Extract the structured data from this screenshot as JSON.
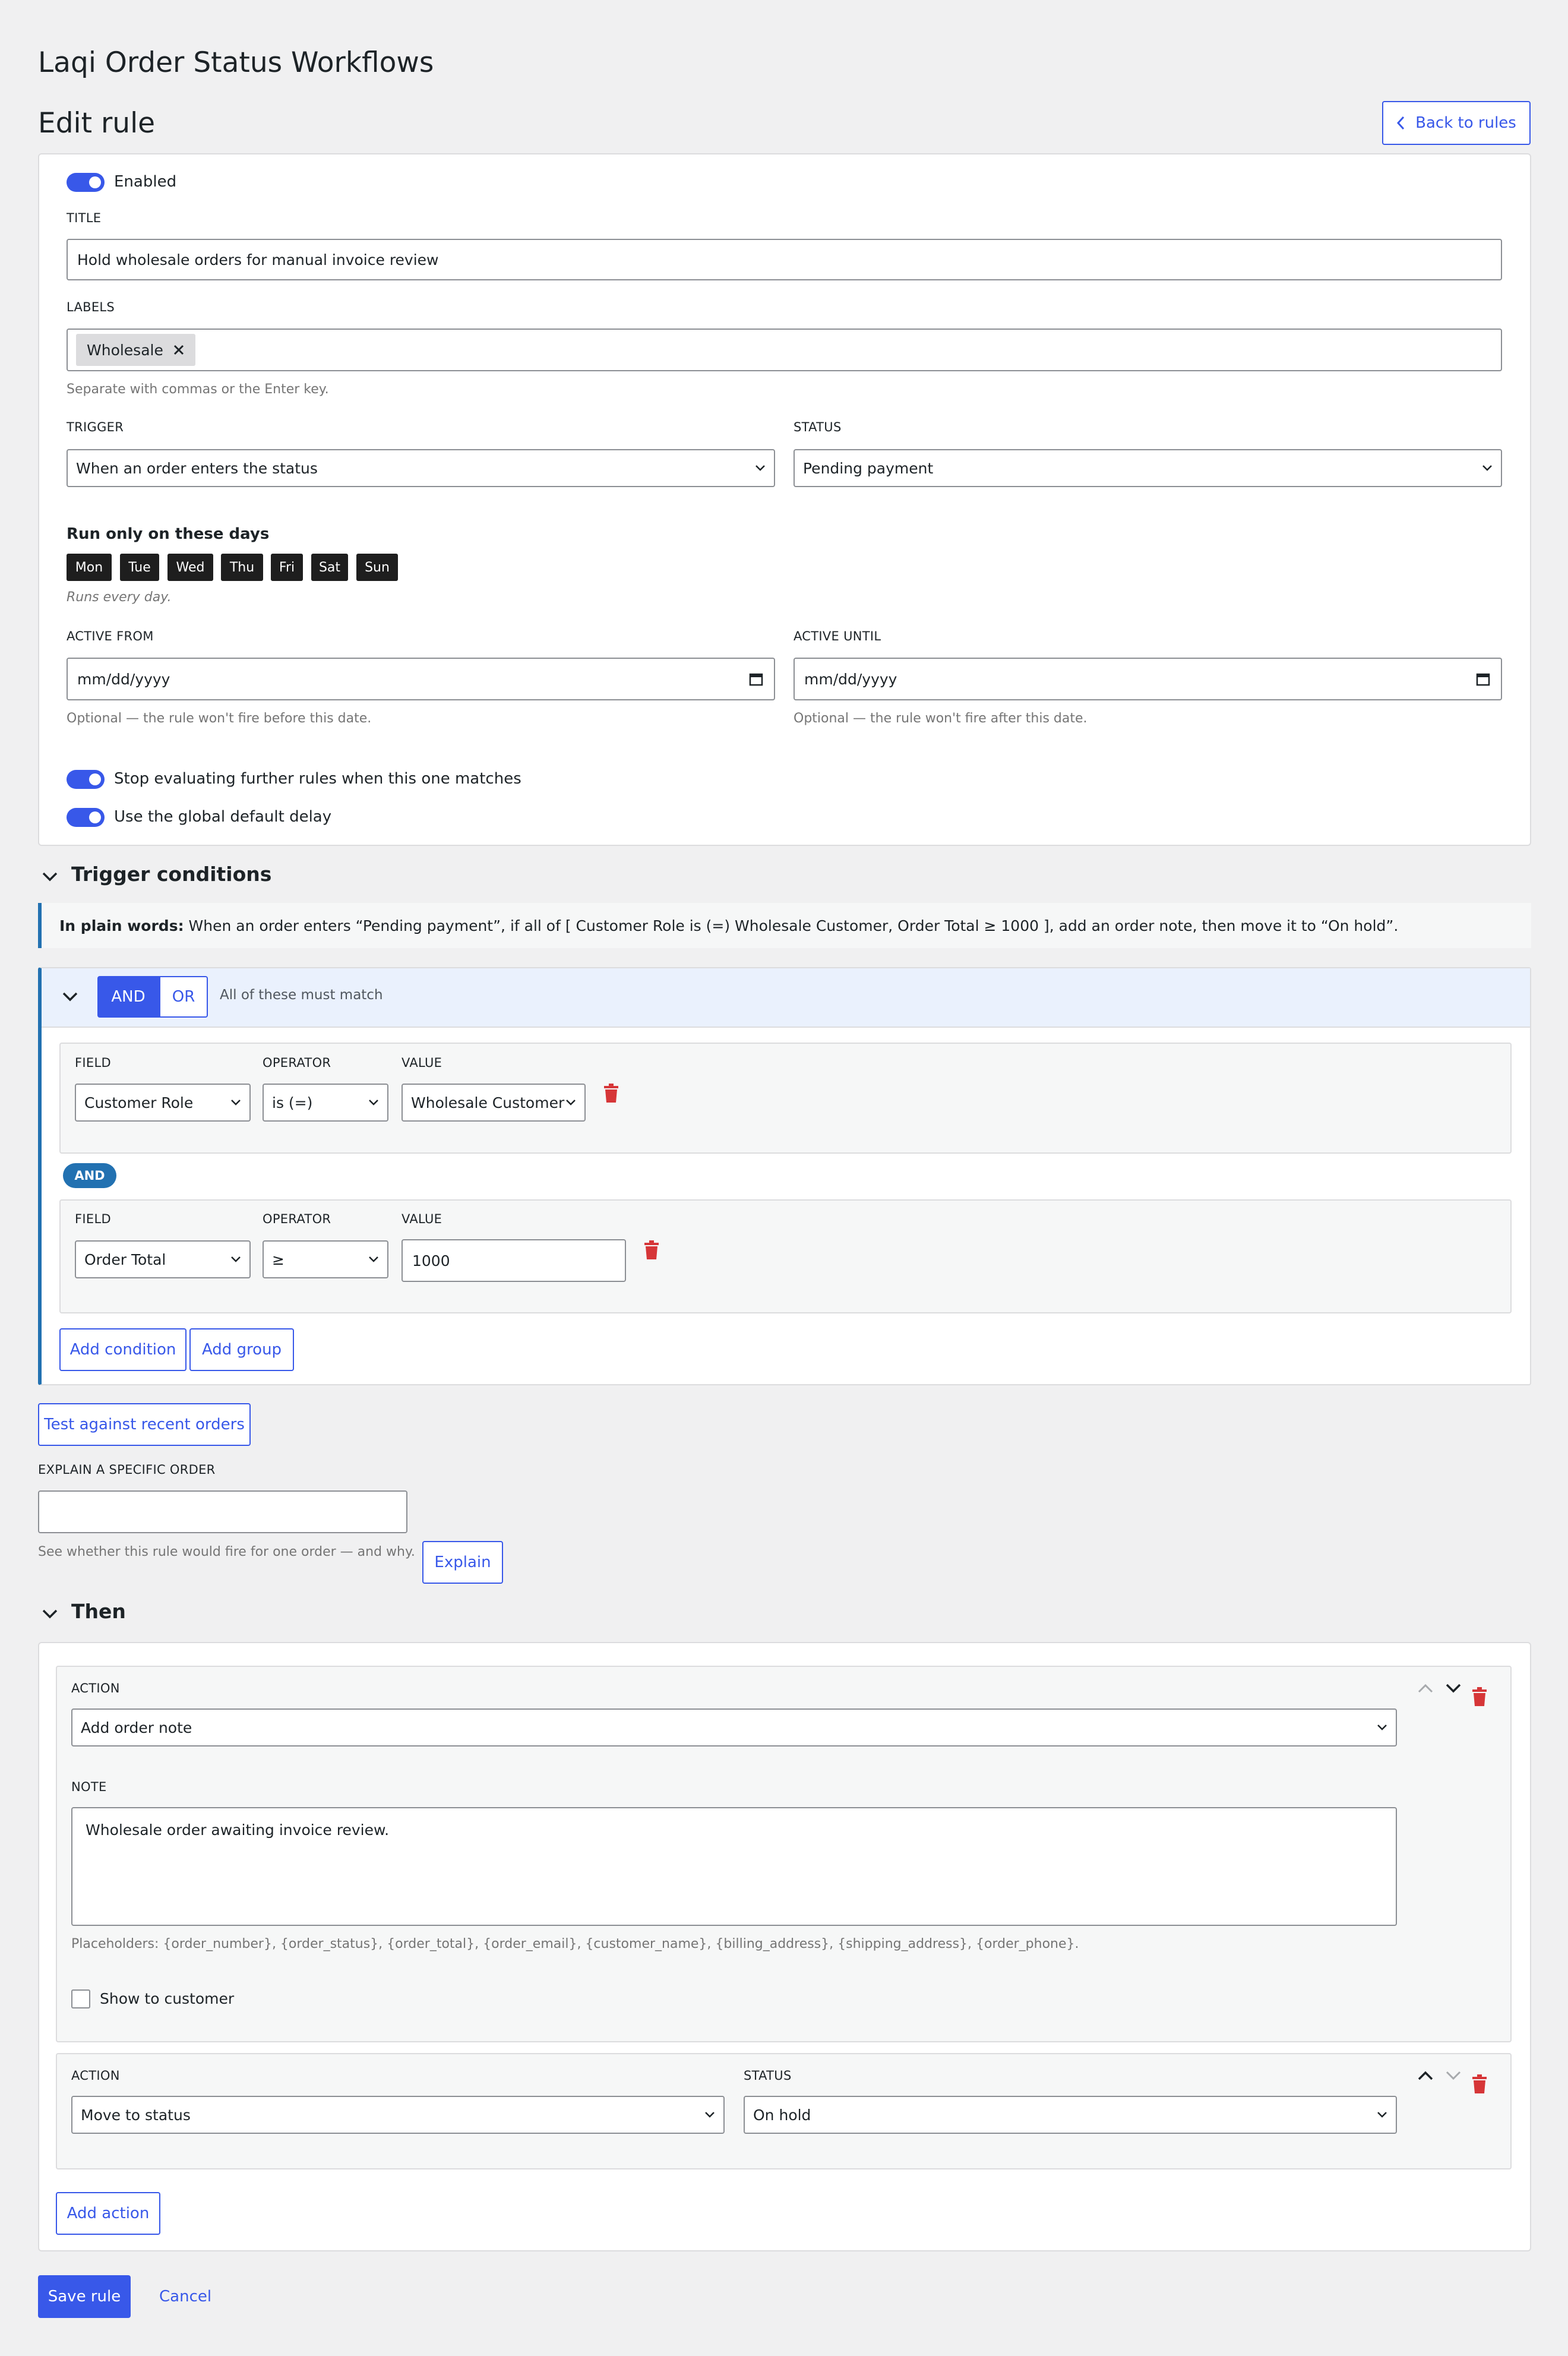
{
  "app_title": "Laqi Order Status Workflows",
  "page_title": "Edit rule",
  "back_button": "Back to rules",
  "enabled_label": "Enabled",
  "title_label": "TITLE",
  "title_value": "Hold wholesale orders for manual invoice review",
  "labels_label": "LABELS",
  "labels_tags": [
    "Wholesale"
  ],
  "labels_help": "Separate with commas or the Enter key.",
  "trigger_label": "TRIGGER",
  "trigger_value": "When an order enters the status",
  "status_label": "STATUS",
  "status_value": "Pending payment",
  "days_heading": "Run only on these days",
  "days": [
    "Mon",
    "Tue",
    "Wed",
    "Thu",
    "Fri",
    "Sat",
    "Sun"
  ],
  "days_help": "Runs every day.",
  "active_from_label": "ACTIVE FROM",
  "active_from_placeholder": "mm/dd/yyyy",
  "active_from_help": "Optional — the rule won't fire before this date.",
  "active_until_label": "ACTIVE UNTIL",
  "active_until_placeholder": "mm/dd/yyyy",
  "active_until_help": "Optional — the rule won't fire after this date.",
  "stop_evaluating_label": "Stop evaluating further rules when this one matches",
  "global_delay_label": "Use the global default delay",
  "conditions_heading": "Trigger conditions",
  "plain_words_prefix": "In plain words:",
  "plain_words_text": "When an order enters “Pending payment”, if all of [ Customer Role is (=) Wholesale Customer, Order Total ≥ 1000 ], add an order note, then move it to “On hold”.",
  "group": {
    "and_label": "AND",
    "or_label": "OR",
    "match_text": "All of these must match",
    "connector": "AND",
    "conditions": [
      {
        "field_label": "FIELD",
        "field": "Customer Role",
        "operator_label": "OPERATOR",
        "operator": "is (=)",
        "value_label": "VALUE",
        "value": "Wholesale Customer"
      },
      {
        "field_label": "FIELD",
        "field": "Order Total",
        "operator_label": "OPERATOR",
        "operator": "≥",
        "value_label": "VALUE",
        "value": "1000"
      }
    ],
    "add_condition": "Add condition",
    "add_group": "Add group"
  },
  "test_button": "Test against recent orders",
  "explain_label": "EXPLAIN A SPECIFIC ORDER",
  "explain_help": "See whether this rule would fire for one order — and why.",
  "explain_button": "Explain",
  "then_heading": "Then",
  "actions": [
    {
      "action_label": "ACTION",
      "action": "Add order note",
      "note_label": "NOTE",
      "note": "Wholesale order awaiting invoice review.",
      "placeholders": "Placeholders: {order_number}, {order_status}, {order_total}, {order_email}, {customer_name}, {billing_address}, {shipping_address}, {order_phone}.",
      "show_to_customer": "Show to customer"
    },
    {
      "action_label": "ACTION",
      "action": "Move to status",
      "status_label": "STATUS",
      "status": "On hold"
    }
  ],
  "add_action": "Add action",
  "save_button": "Save rule",
  "cancel_link": "Cancel",
  "colors": {
    "accent": "#3858e9",
    "danger": "#d63638",
    "plain_border": "#2271b1"
  }
}
